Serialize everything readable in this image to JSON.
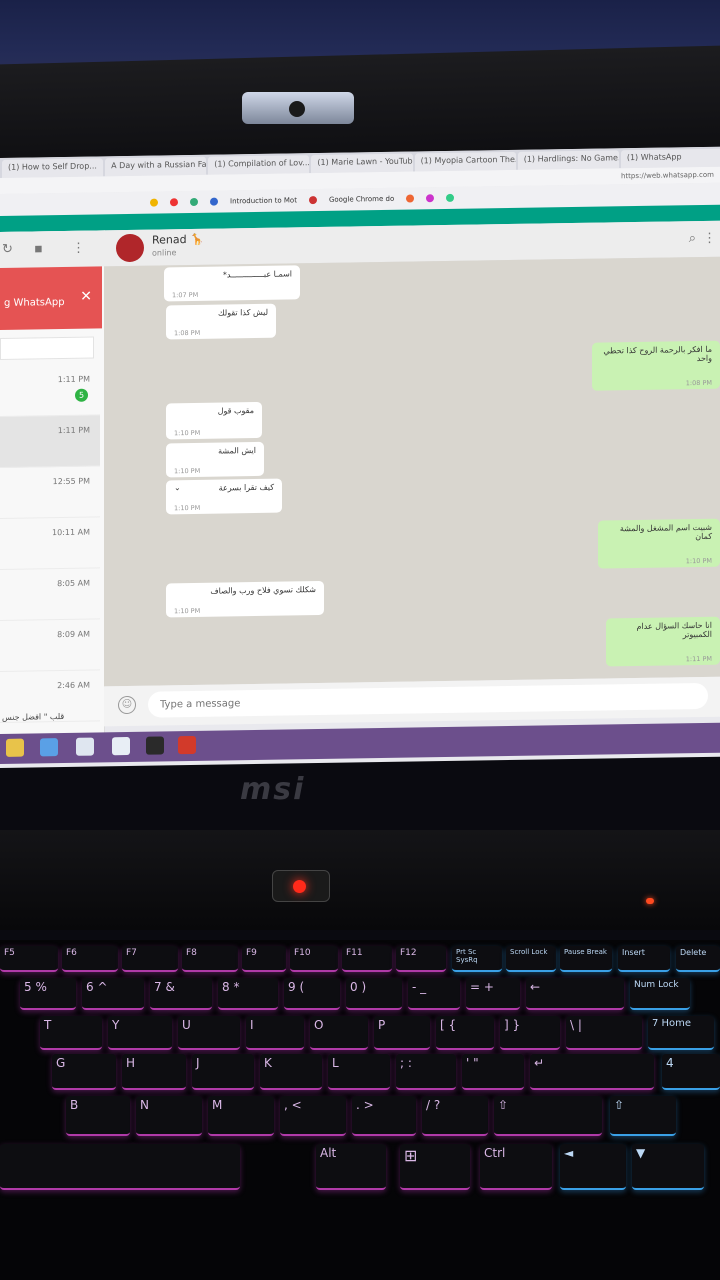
{
  "browser": {
    "tabs": [
      "(1) How to Self Drop...",
      "A Day with a Russian Fa...",
      "(1) Compilation of Lov...",
      "(1) Marie Lawn - YouTub...",
      "(1) Myopia Cartoon The...",
      "(1) Hardlings: No Game...",
      "(1) WhatsApp"
    ],
    "url": "https://web.whatsapp.com",
    "bookmarks": [
      "Introduction to Mot",
      "Google Chrome do"
    ]
  },
  "sidebar": {
    "notification_text": "g WhatsApp",
    "chats": [
      {
        "time": "1:11 PM",
        "badge": "5"
      },
      {
        "time": "1:11 PM"
      },
      {
        "time": "12:55 PM"
      },
      {
        "time": "10:11 AM"
      },
      {
        "time": "8:05 AM"
      },
      {
        "time": "8:09 AM"
      },
      {
        "time": "2:46 AM"
      }
    ],
    "last_preview": "قلب \" افضل جنس"
  },
  "chat": {
    "contact_name": "Renad 🦒",
    "contact_status": "online",
    "input_placeholder": "Type a message",
    "messages": [
      {
        "dir": "in",
        "text": "اسمـا عبــــــــــــــد*",
        "time": "1:07 PM"
      },
      {
        "dir": "in",
        "text": "ليش كذا تقولك",
        "time": "1:08 PM"
      },
      {
        "dir": "out",
        "text": "ما افكر بالرحمة الروح كذا تحطي واحد",
        "time": "1:08 PM"
      },
      {
        "dir": "in",
        "text": "مقوب قول",
        "time": "1:10 PM"
      },
      {
        "dir": "in",
        "text": "ايش المشة",
        "time": "1:10 PM"
      },
      {
        "dir": "in",
        "text": "كيف تقرا بسرعة",
        "time": "1:10 PM"
      },
      {
        "dir": "out",
        "text": "شبيت اسم المشغل والمشة كمان",
        "time": "1:10 PM"
      },
      {
        "dir": "in",
        "text": "شكلك تسوي فلاح ورب والصاف",
        "time": "1:10 PM"
      },
      {
        "dir": "out",
        "text": "انا حاسك السؤال عدام الكمبيوتر",
        "time": "1:11 PM"
      }
    ]
  },
  "device": {
    "brand": "msi"
  },
  "keyboard": {
    "rows": [
      [
        "F5",
        "F6",
        "F7",
        "F8",
        "F9",
        "F10",
        "F11",
        "F12",
        "Prt Sc SysRq",
        "Scroll Lock",
        "Pause Break",
        "Insert",
        "Delete"
      ],
      [
        "5 %",
        "6 ^",
        "7 &",
        "8 *",
        "9 (",
        "0 )",
        "- _",
        "= +",
        "←",
        "Num Lock"
      ],
      [
        "T",
        "Y",
        "U",
        "I",
        "O",
        "P",
        "[ {",
        "] }",
        "\\ |",
        "7 Home"
      ],
      [
        "G",
        "H",
        "J",
        "K",
        "L",
        "; :",
        "' \"",
        "↵",
        "4"
      ],
      [
        "B",
        "N",
        "M",
        ", <",
        ". >",
        "/ ?",
        "⇧",
        "⇧"
      ],
      [
        "",
        "Alt",
        "⊞",
        "Ctrl",
        "◄",
        "▼"
      ]
    ]
  },
  "colors": {
    "whatsapp_green": "#00a085",
    "outgoing_bubble": "#c9f2b3",
    "notification_red": "#e55353",
    "key_backlight": "#b03aa8"
  }
}
